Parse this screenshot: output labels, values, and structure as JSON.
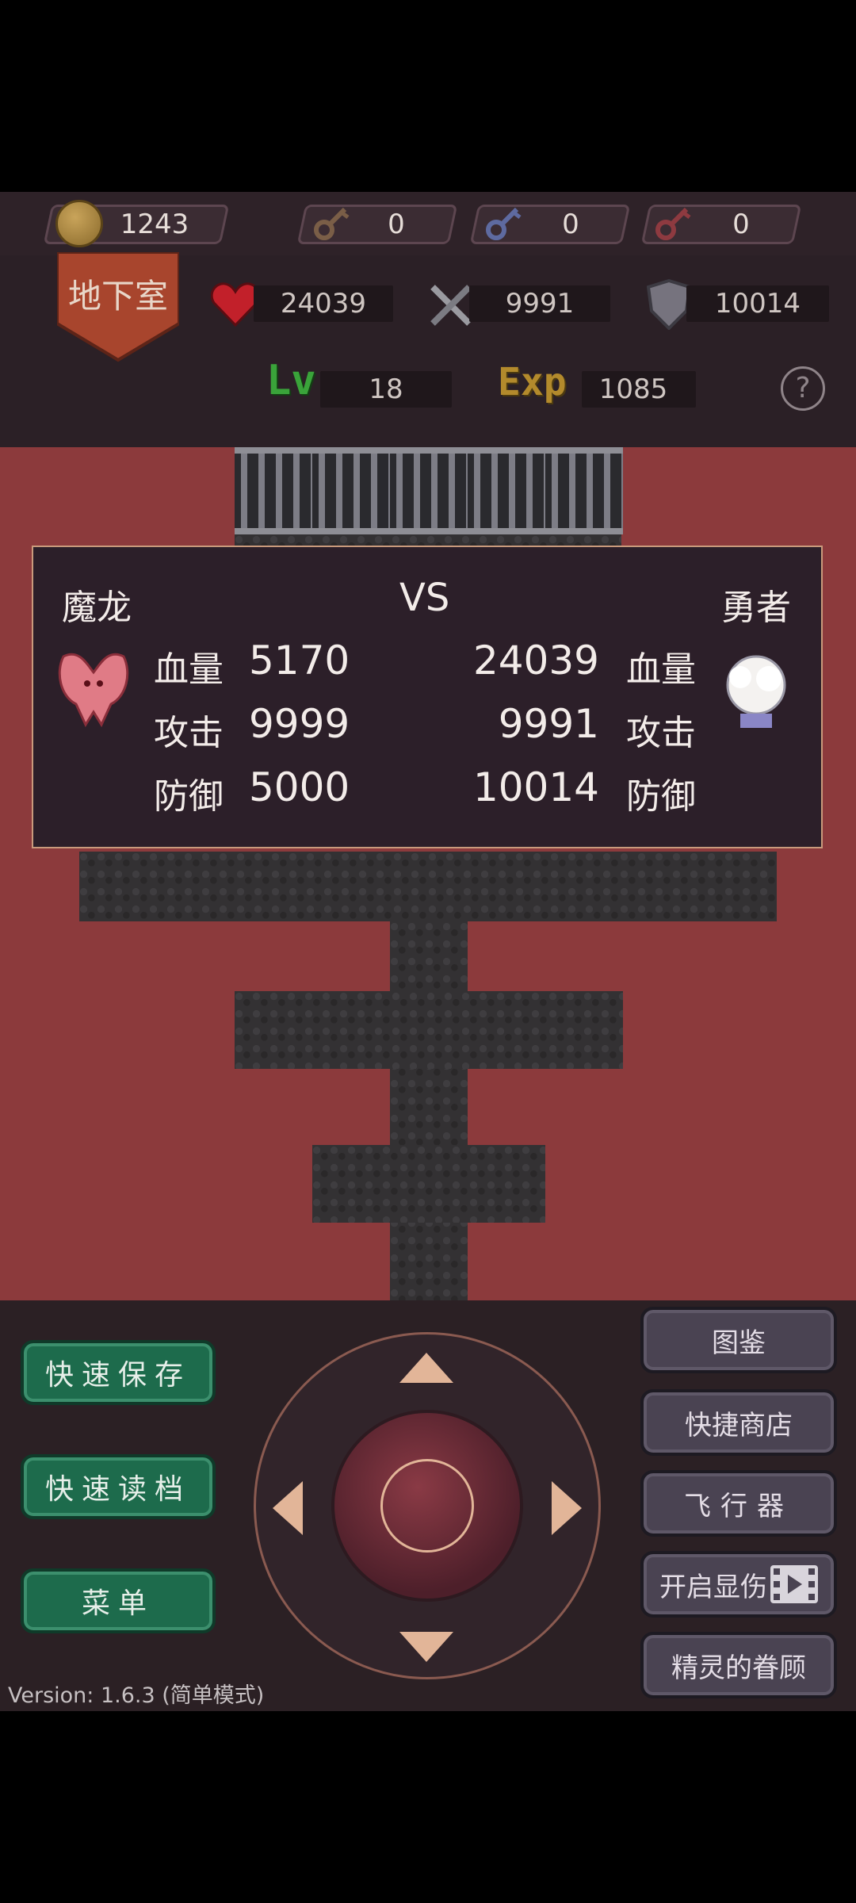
{
  "resources": {
    "gold": "1243",
    "yellow_keys": "0",
    "blue_keys": "0",
    "red_keys": "0"
  },
  "location": "地下室",
  "hero_stats": {
    "hp": "24039",
    "attack": "9991",
    "defense": "10014",
    "lv_label": "Lv",
    "level": "18",
    "exp_label": "Exp",
    "exp": "1085",
    "help": "?"
  },
  "battle": {
    "enemy_name": "魔龙",
    "vs": "VS",
    "hero_name": "勇者",
    "hp_label": "血量",
    "atk_label": "攻击",
    "def_label": "防御",
    "enemy": {
      "hp": "5170",
      "attack": "9999",
      "defense": "5000"
    },
    "hero": {
      "hp": "24039",
      "attack": "9991",
      "defense": "10014"
    }
  },
  "left_buttons": {
    "quick_save": "快速保存",
    "quick_load": "快速读档",
    "menu": "菜单"
  },
  "right_buttons": {
    "bestiary": "图鉴",
    "quick_shop": "快捷商店",
    "flyer": "飞行器",
    "show_damage": "开启显伤",
    "fairy_favor": "精灵的眷顾"
  },
  "version": "Version: 1.6.3 (简单模式)",
  "colors": {
    "green_button": "#1d6b4c",
    "slate_button": "#4a4352",
    "map_red": "#8c3a3c",
    "panel_border": "#c99a7c"
  }
}
